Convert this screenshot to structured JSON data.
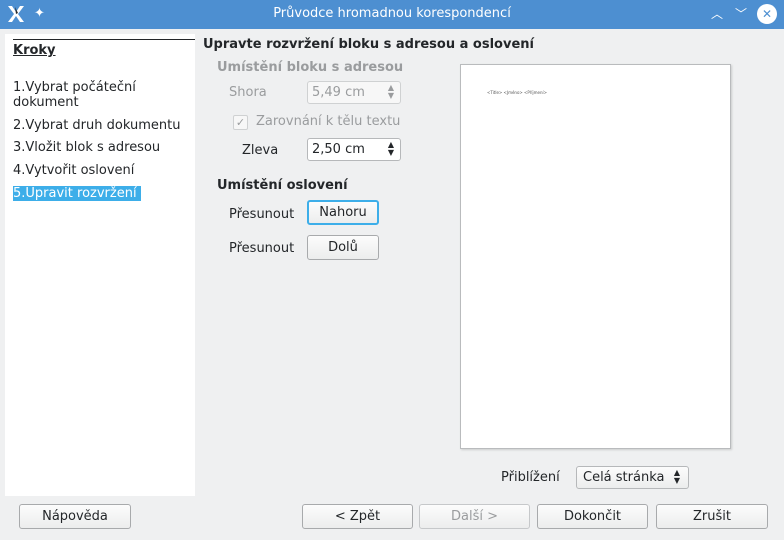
{
  "window": {
    "title": "Průvodce hromadnou korespondencí",
    "accent": "#4d8fd1"
  },
  "sidebar": {
    "heading": "Kroky",
    "steps": [
      {
        "label": "1.Vybrat počáteční dokument",
        "active": false
      },
      {
        "label": "2.Vybrat druh dokumentu",
        "active": false
      },
      {
        "label": "3.Vložit blok s adresou",
        "active": false
      },
      {
        "label": "4.Vytvořit oslovení",
        "active": false
      },
      {
        "label": "5.Upravit rozvržení",
        "active": true
      }
    ],
    "highlight": "#3daee9"
  },
  "main": {
    "title": "Upravte rozvržení bloku s adresou a oslovení",
    "address_block": {
      "title": "Umístění bloku s adresou",
      "top_label": "Shora",
      "top_value": "5,49 cm",
      "align_label": "Zarovnání k tělu textu",
      "align_checked": true,
      "left_label": "Zleva",
      "left_value": "2,50 cm"
    },
    "salutation": {
      "title": "Umístění oslovení",
      "move_label_1": "Přesunout",
      "up_button": "Nahoru",
      "move_label_2": "Přesunout",
      "down_button": "Dolů"
    },
    "preview": {
      "address_text": "<Title> <Jméno> <Příjmení>"
    },
    "zoom": {
      "label": "Přiblížení",
      "value": "Celá stránka"
    }
  },
  "footer": {
    "help": "Nápověda",
    "back": "< Zpět",
    "next": "Další >",
    "finish": "Dokončit",
    "cancel": "Zrušit"
  }
}
